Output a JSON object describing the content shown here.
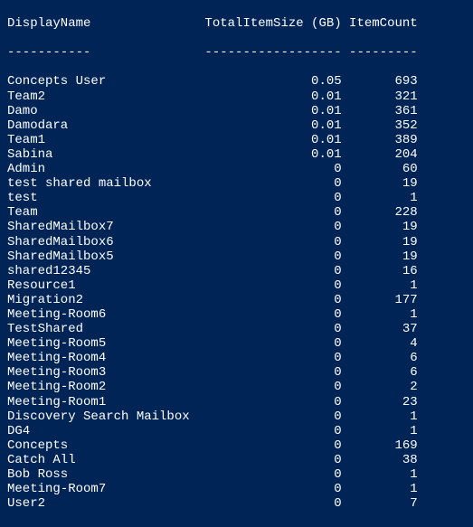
{
  "chart_data": {
    "type": "table",
    "title": "",
    "columns": [
      "DisplayName",
      "TotalItemSize (GB)",
      "ItemCount"
    ],
    "rows": [
      {
        "display_name": "Concepts User",
        "total_item_size_gb": 0.05,
        "item_count": 693
      },
      {
        "display_name": "Team2",
        "total_item_size_gb": 0.01,
        "item_count": 321
      },
      {
        "display_name": "Damo",
        "total_item_size_gb": 0.01,
        "item_count": 361
      },
      {
        "display_name": "Damodara",
        "total_item_size_gb": 0.01,
        "item_count": 352
      },
      {
        "display_name": "Team1",
        "total_item_size_gb": 0.01,
        "item_count": 389
      },
      {
        "display_name": "Sabina",
        "total_item_size_gb": 0.01,
        "item_count": 204
      },
      {
        "display_name": "Admin",
        "total_item_size_gb": 0,
        "item_count": 60
      },
      {
        "display_name": "test shared mailbox",
        "total_item_size_gb": 0,
        "item_count": 19
      },
      {
        "display_name": "test",
        "total_item_size_gb": 0,
        "item_count": 1
      },
      {
        "display_name": "Team",
        "total_item_size_gb": 0,
        "item_count": 228
      },
      {
        "display_name": "SharedMailbox7",
        "total_item_size_gb": 0,
        "item_count": 19
      },
      {
        "display_name": "SharedMailbox6",
        "total_item_size_gb": 0,
        "item_count": 19
      },
      {
        "display_name": "SharedMailbox5",
        "total_item_size_gb": 0,
        "item_count": 19
      },
      {
        "display_name": "shared12345",
        "total_item_size_gb": 0,
        "item_count": 16
      },
      {
        "display_name": "Resource1",
        "total_item_size_gb": 0,
        "item_count": 1
      },
      {
        "display_name": "Migration2",
        "total_item_size_gb": 0,
        "item_count": 177
      },
      {
        "display_name": "Meeting-Room6",
        "total_item_size_gb": 0,
        "item_count": 1
      },
      {
        "display_name": "TestShared",
        "total_item_size_gb": 0,
        "item_count": 37
      },
      {
        "display_name": "Meeting-Room5",
        "total_item_size_gb": 0,
        "item_count": 4
      },
      {
        "display_name": "Meeting-Room4",
        "total_item_size_gb": 0,
        "item_count": 6
      },
      {
        "display_name": "Meeting-Room3",
        "total_item_size_gb": 0,
        "item_count": 6
      },
      {
        "display_name": "Meeting-Room2",
        "total_item_size_gb": 0,
        "item_count": 2
      },
      {
        "display_name": "Meeting-Room1",
        "total_item_size_gb": 0,
        "item_count": 23
      },
      {
        "display_name": "Discovery Search Mailbox",
        "total_item_size_gb": 0,
        "item_count": 1
      },
      {
        "display_name": "DG4",
        "total_item_size_gb": 0,
        "item_count": 1
      },
      {
        "display_name": "Concepts",
        "total_item_size_gb": 0,
        "item_count": 169
      },
      {
        "display_name": "Catch All",
        "total_item_size_gb": 0,
        "item_count": 38
      },
      {
        "display_name": "Bob Ross",
        "total_item_size_gb": 0,
        "item_count": 1
      },
      {
        "display_name": "Meeting-Room7",
        "total_item_size_gb": 0,
        "item_count": 1
      },
      {
        "display_name": "User2",
        "total_item_size_gb": 0,
        "item_count": 7
      }
    ]
  },
  "layout": {
    "col1_width": 26,
    "col2_width": 18,
    "col3_width": 10
  }
}
